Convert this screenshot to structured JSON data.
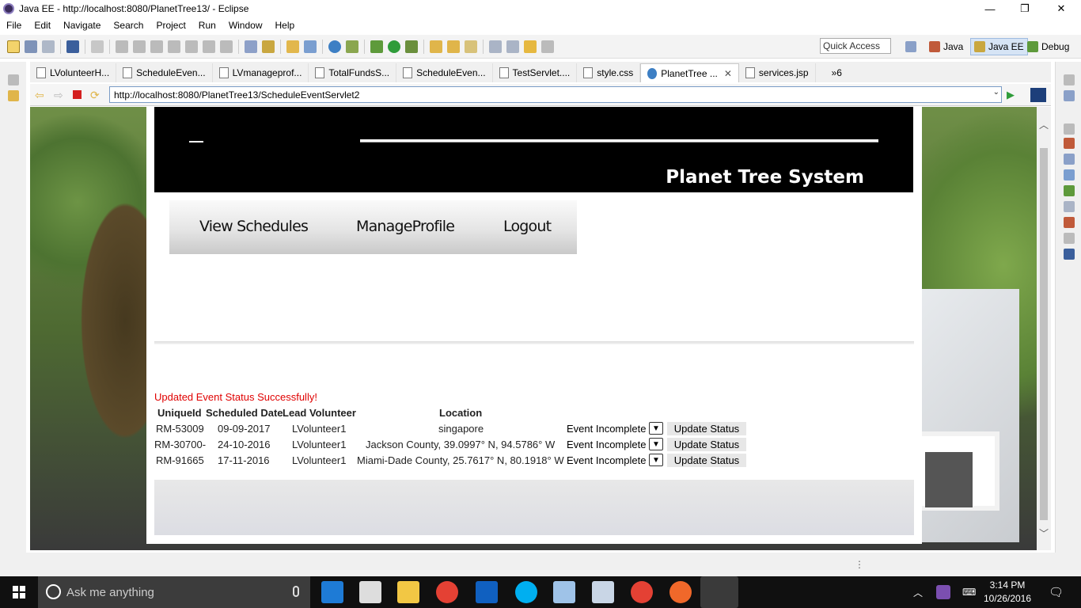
{
  "window": {
    "title": "Java EE - http://localhost:8080/PlanetTree13/ - Eclipse",
    "minimize": "—",
    "restore": "❐",
    "close": "✕"
  },
  "menubar": [
    "File",
    "Edit",
    "Navigate",
    "Search",
    "Project",
    "Run",
    "Window",
    "Help"
  ],
  "toolbar": {
    "quick_access_placeholder": "Quick Access",
    "perspectives": [
      {
        "label": "Java",
        "active": false
      },
      {
        "label": "Java EE",
        "active": true
      },
      {
        "label": "Debug",
        "active": false
      }
    ]
  },
  "editor_tabs": [
    {
      "label": "LVolunteerH...",
      "active": false
    },
    {
      "label": "ScheduleEven...",
      "active": false
    },
    {
      "label": "LVmanageprof...",
      "active": false
    },
    {
      "label": "TotalFundsS...",
      "active": false
    },
    {
      "label": "ScheduleEven...",
      "active": false
    },
    {
      "label": "TestServlet....",
      "active": false
    },
    {
      "label": "style.css",
      "active": false
    },
    {
      "label": "PlanetTree ...",
      "active": true
    },
    {
      "label": "services.jsp",
      "active": false
    }
  ],
  "tab_overflow": "»6",
  "browser": {
    "url": "http://localhost:8080/PlanetTree13/ScheduleEventServlet2"
  },
  "site": {
    "title": "Planet Tree System",
    "nav": [
      "View Schedules",
      "ManageProfile",
      "Logout"
    ],
    "status_message": "Updated Event Status Successfully!",
    "table": {
      "headers": [
        "UniqueId",
        "Scheduled Date",
        "Lead Volunteer",
        "Location"
      ],
      "rows": [
        {
          "id": "RM-53009",
          "date": "09-09-2017",
          "lead": "LVolunteer1",
          "location": "singapore",
          "status": "Event Incomplete",
          "button": "Update Status"
        },
        {
          "id": "RM-30700-",
          "date": "24-10-2016",
          "lead": "LVolunteer1",
          "location": "Jackson County, 39.0997° N, 94.5786° W",
          "status": "Event Incomplete",
          "button": "Update Status"
        },
        {
          "id": "RM-91665",
          "date": "17-11-2016",
          "lead": "LVolunteer1",
          "location": "Miami-Dade County, 25.7617° N, 80.1918° W",
          "status": "Event Incomplete",
          "button": "Update Status"
        }
      ]
    }
  },
  "taskbar": {
    "search_placeholder": "Ask me anything",
    "clock_time": "3:14 PM",
    "clock_date": "10/26/2016"
  }
}
